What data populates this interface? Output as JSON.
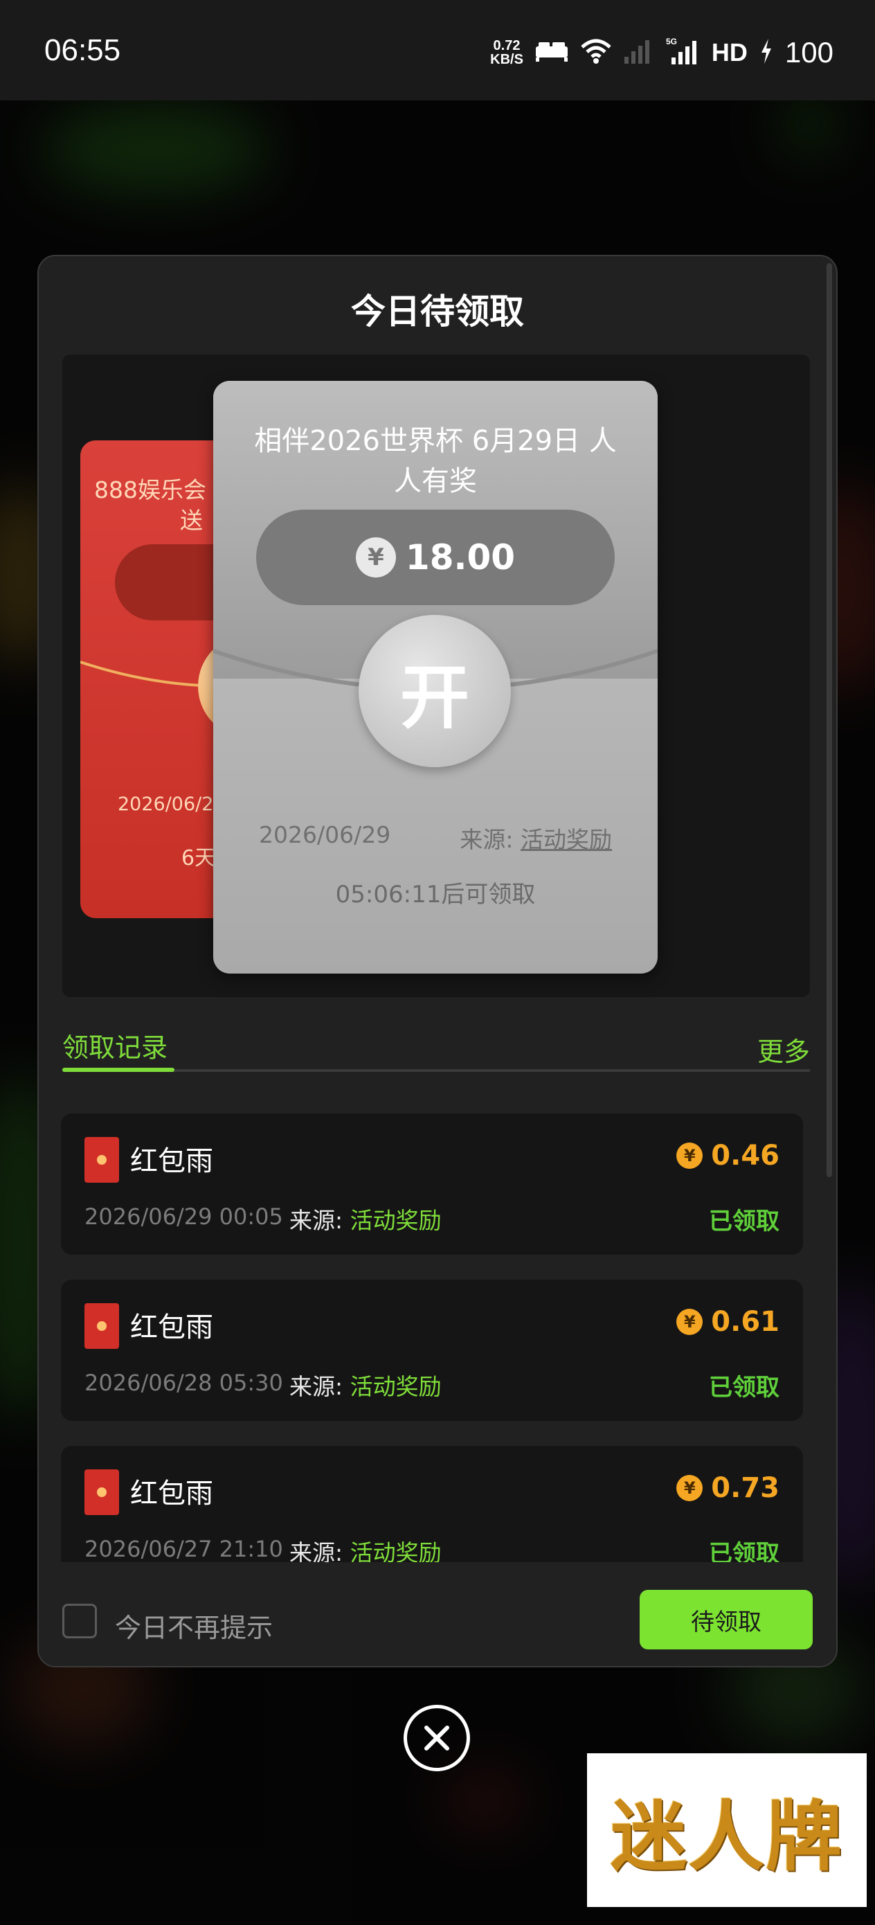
{
  "status_bar": {
    "time": "06:55",
    "net_speed_value": "0.72",
    "net_speed_unit": "KB/S",
    "network_type": "5G",
    "hd_label": "HD",
    "battery": "100"
  },
  "modal": {
    "title": "今日待领取",
    "cards": [
      {
        "title": "888娱乐会",
        "title_line2": "送",
        "date": "2026/06/28",
        "countdown": "6天",
        "color": "#d43a32"
      },
      {
        "title": "相伴2026世界杯 6月29日 人人有奖",
        "currency_symbol": "¥",
        "amount": "18.00",
        "open_label": "开",
        "date": "2026/06/29",
        "source_label": "来源:",
        "source_value": "活动奖励",
        "countdown": "05:06:11后可领取"
      }
    ],
    "tabs": {
      "records_label": "领取记录",
      "more_label": "更多"
    },
    "records": [
      {
        "title": "红包雨",
        "amount": "0.46",
        "date": "2026/06/29 00:05",
        "source_label": "来源:",
        "source_value": "活动奖励",
        "status": "已领取"
      },
      {
        "title": "红包雨",
        "amount": "0.61",
        "date": "2026/06/28 05:30",
        "source_label": "来源:",
        "source_value": "活动奖励",
        "status": "已领取"
      },
      {
        "title": "红包雨",
        "amount": "0.73",
        "date": "2026/06/27 21:10",
        "source_label": "来源:",
        "source_value": "活动奖励",
        "status": "已领取"
      }
    ],
    "footer": {
      "dont_show_label": "今日不再提示",
      "dont_show_checked": false,
      "pending_button_label": "待领取"
    }
  },
  "watermark": {
    "text": "迷人牌"
  },
  "colors": {
    "accent_green": "#7fdd3a",
    "amount_orange": "#f5a623",
    "modal_bg": "#212121",
    "card_gray": "#b5b5b5",
    "card_red": "#d43a32"
  },
  "icons": [
    "wifi-icon",
    "bed-icon",
    "signal-icon",
    "battery-charging-icon",
    "red-envelope-icon",
    "coin-icon",
    "yen-icon",
    "close-icon"
  ]
}
